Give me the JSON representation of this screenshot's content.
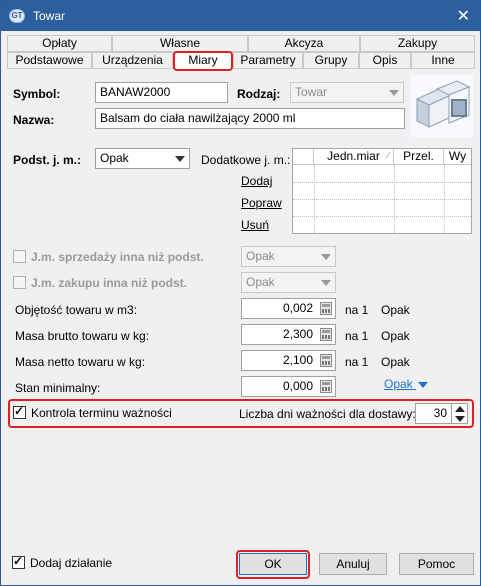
{
  "window": {
    "title": "Towar",
    "app_icon_text": "GT",
    "close_glyph": "✕"
  },
  "tabs_row1": [
    "Opłaty",
    "Własne",
    "Akcyza",
    "Zakupy"
  ],
  "tabs_row2": [
    "Podstawowe",
    "Urządzenia",
    "Miary",
    "Parametry",
    "Grupy",
    "Opis",
    "Inne"
  ],
  "active_tab": "Miary",
  "form": {
    "symbol_label": "Symbol:",
    "symbol_value": "BANAW2000",
    "rodzaj_label": "Rodzaj:",
    "rodzaj_value": "Towar",
    "nazwa_label": "Nazwa:",
    "nazwa_value": "Balsam do ciała nawilżający 2000 ml",
    "podst_label": "Podst. j. m.:",
    "podst_value": "Opak",
    "dodatkowe_label": "Dodatkowe j. m.:",
    "grid_headers": [
      "Jedn.miar",
      "Przel.",
      "Wy"
    ],
    "grid_sort_glyph": "⁄",
    "links": {
      "dodaj": "Dodaj",
      "popraw": "Popraw",
      "usun": "Usuń"
    },
    "jm_sprzedazy_label": "J.m. sprzedaży inna niż podst.",
    "jm_sprzedazy_value": "Opak",
    "jm_zakupu_label": "J.m. zakupu inna niż podst.",
    "jm_zakupu_value": "Opak",
    "objetosc_label": "Objętość towaru w m3:",
    "objetosc_value": "0,002",
    "masa_brutto_label": "Masa brutto towaru w kg:",
    "masa_brutto_value": "2,300",
    "masa_netto_label": "Masa netto towaru w kg:",
    "masa_netto_value": "2,100",
    "stan_label": "Stan minimalny:",
    "stan_value": "0,000",
    "na1": "na 1",
    "unit": "Opak",
    "stan_unit_link": "Opak",
    "kontrola_label": "Kontrola terminu ważności",
    "liczba_dni_label": "Liczba dni ważności dla dostawy:",
    "liczba_dni_value": "30"
  },
  "footer": {
    "dodaj_dzialanie_label": "Dodaj działanie",
    "ok_label": "OK",
    "anuluj_label": "Anuluj",
    "pomoc_label": "Pomoc"
  },
  "colors": {
    "title_bar": "#2d5f9e",
    "highlight": "#e02020",
    "link_blue": "#1e6fd1"
  }
}
